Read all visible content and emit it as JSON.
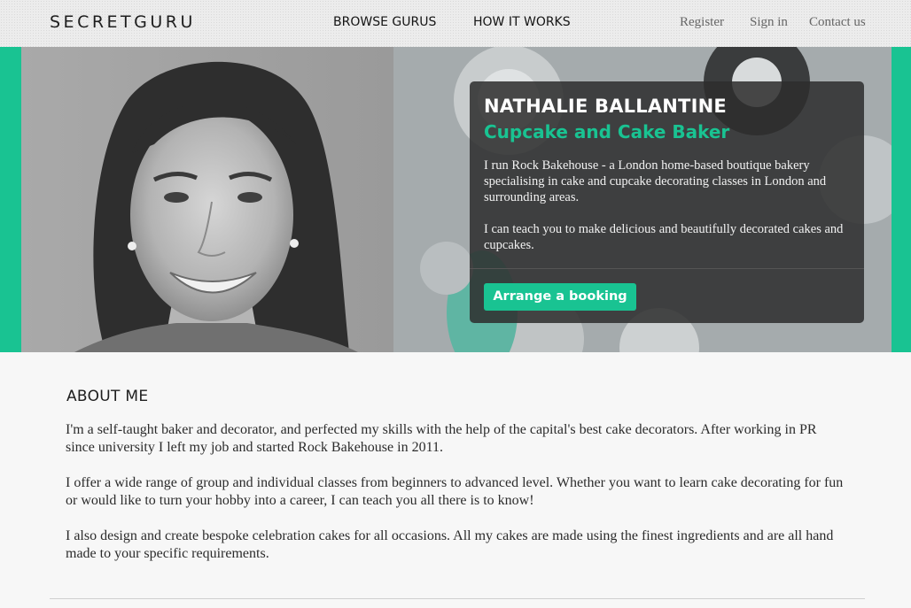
{
  "header": {
    "logo": "SECRETGURU",
    "nav": {
      "browse": "BROWSE GURUS",
      "how": "HOW IT WORKS"
    },
    "utility": {
      "register": "Register",
      "signin": "Sign in",
      "contact": "Contact us"
    }
  },
  "hero": {
    "name": "NATHALIE BALLANTINE",
    "role": "Cupcake and Cake Baker",
    "bio": [
      "I run Rock Bakehouse - a London home-based boutique bakery specialising in cake and cupcake decorating classes in London and surrounding areas.",
      "I can teach you to make delicious and beautifully decorated cakes and cupcakes."
    ],
    "button": "Arrange a booking"
  },
  "about": {
    "heading": "ABOUT ME",
    "paragraphs": [
      "I'm a self-taught baker and decorator, and perfected my skills with the help of the capital's best cake decorators. After working in PR since university I left my job and started Rock Bakehouse in 2011.",
      "I offer a wide range of group and individual classes from beginners to advanced level. Whether you want to learn cake decorating for fun or would like to turn your hobby into a career, I can teach you all there is to know!",
      "I also design and create bespoke celebration cakes for all occasions. All my cakes are made using the finest ingredients and are all hand made to your specific requirements."
    ]
  },
  "colors": {
    "accent": "#19c392",
    "card_bg": "#2d2d2d",
    "header_bg": "#ececec"
  }
}
